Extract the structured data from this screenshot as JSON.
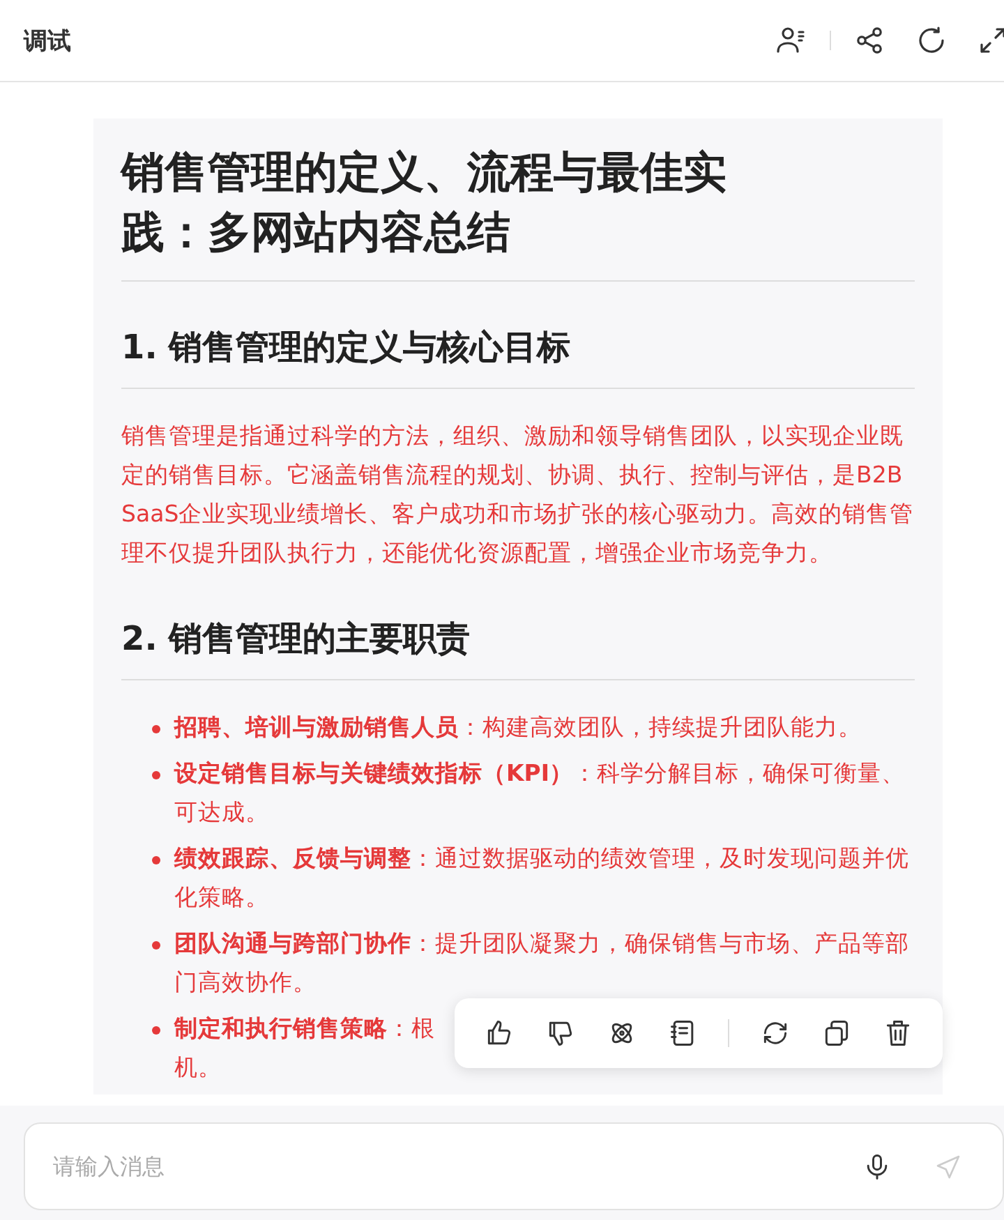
{
  "header": {
    "title": "调试"
  },
  "article": {
    "title": "销售管理的定义、流程与最佳实践：多网站内容总结",
    "sections": [
      {
        "heading": "1. 销售管理的定义与核心目标",
        "paragraph": "销售管理是指通过科学的方法，组织、激励和领导销售团队，以实现企业既定的销售目标。它涵盖销售流程的规划、协调、执行、控制与评估，是B2B SaaS企业实现业绩增长、客户成功和市场扩张的核心驱动力。高效的销售管理不仅提升团队执行力，还能优化资源配置，增强企业市场竞争力。"
      },
      {
        "heading": "2. 销售管理的主要职责",
        "items": [
          "**招聘、培训与激励销售人员**：构建高效团队，持续提升团队能力。",
          "**设定销售目标与关键绩效指标（KPI）**：科学分解目标，确保可衡量、可达成。",
          "**绩效跟踪、反馈与调整**：通过数据驱动的绩效管理，及时发现问题并优化策略。",
          "**团队沟通与跨部门协作**：提升团队凝聚力，确保销售与市场、产品等部门高效协作。",
          {
            "text": "**制定和执行销售策略**：根",
            "next_line": "机。"
          }
        ]
      }
    ]
  },
  "input": {
    "placeholder": "请输入消息"
  }
}
